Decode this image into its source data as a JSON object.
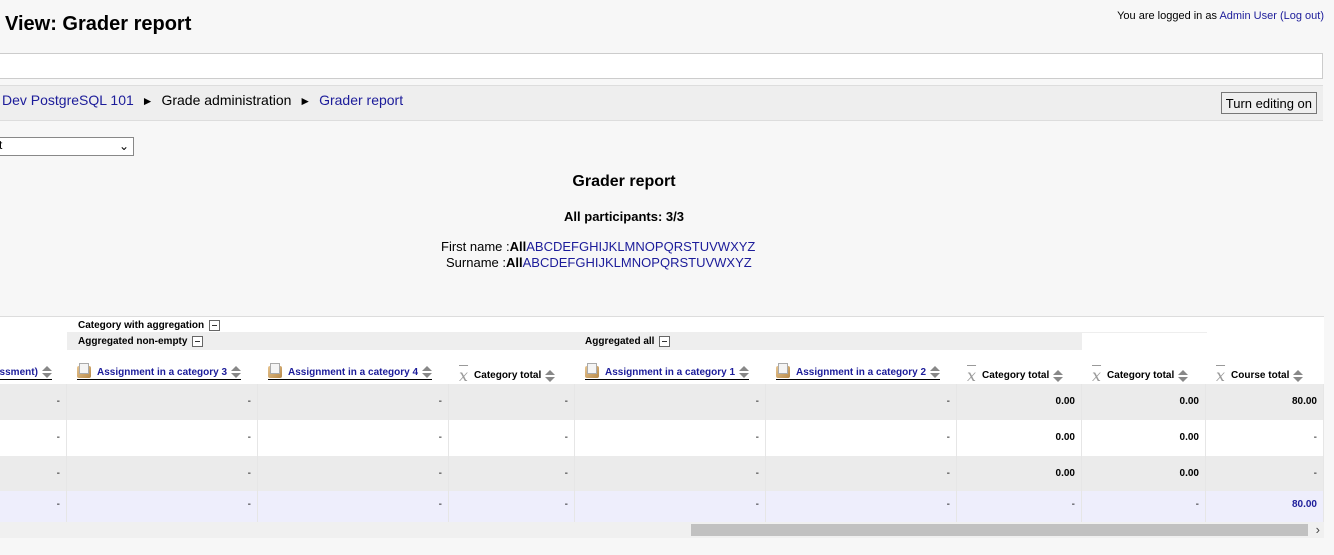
{
  "page": {
    "title": "View: Grader report",
    "login_prefix": "You are logged in as",
    "login_user": "Admin User",
    "logout": "(Log out)"
  },
  "breadcrumb": {
    "course": "Dev PostgreSQL 101",
    "sep": "►",
    "grade_admin": "Grade administration",
    "grader_report": "Grader report"
  },
  "toolbar": {
    "turn_editing": "Turn editing on",
    "view_select_value": "t",
    "chevron": "⌄"
  },
  "report": {
    "title": "Grader report",
    "participants": "All participants: 3/3",
    "first_name_label": "First name :",
    "surname_label": "Surname :",
    "all": "All",
    "letters": [
      "A",
      "B",
      "C",
      "D",
      "E",
      "F",
      "G",
      "H",
      "I",
      "J",
      "K",
      "L",
      "M",
      "N",
      "O",
      "P",
      "Q",
      "R",
      "S",
      "T",
      "U",
      "V",
      "W",
      "X",
      "Y",
      "Z"
    ]
  },
  "table": {
    "category_with_aggregation": "Category with aggregation",
    "aggregated_non_empty": "Aggregated non-empty",
    "aggregated_all": "Aggregated all",
    "columns": [
      {
        "label": "essment)",
        "type": "link"
      },
      {
        "label": "Assignment in a category 3",
        "type": "assign"
      },
      {
        "label": "Assignment in a category 4",
        "type": "assign"
      },
      {
        "label": "Category total",
        "type": "total"
      },
      {
        "label": "Assignment in a category 1",
        "type": "assign"
      },
      {
        "label": "Assignment in a category 2",
        "type": "assign"
      },
      {
        "label": "Category total",
        "type": "total"
      },
      {
        "label": "Category total",
        "type": "total"
      },
      {
        "label": "Course total",
        "type": "total"
      }
    ],
    "rows": [
      [
        "-",
        "-",
        "-",
        "-",
        "-",
        "-",
        "0.00",
        "0.00",
        "80.00"
      ],
      [
        "-",
        "-",
        "-",
        "-",
        "-",
        "-",
        "0.00",
        "0.00",
        "-"
      ],
      [
        "-",
        "-",
        "-",
        "-",
        "-",
        "-",
        "0.00",
        "0.00",
        "-"
      ],
      [
        "-",
        "-",
        "-",
        "-",
        "-",
        "-",
        "-",
        "-",
        "80.00"
      ]
    ],
    "xbar_glyph": "x",
    "scroll_right": "›"
  }
}
